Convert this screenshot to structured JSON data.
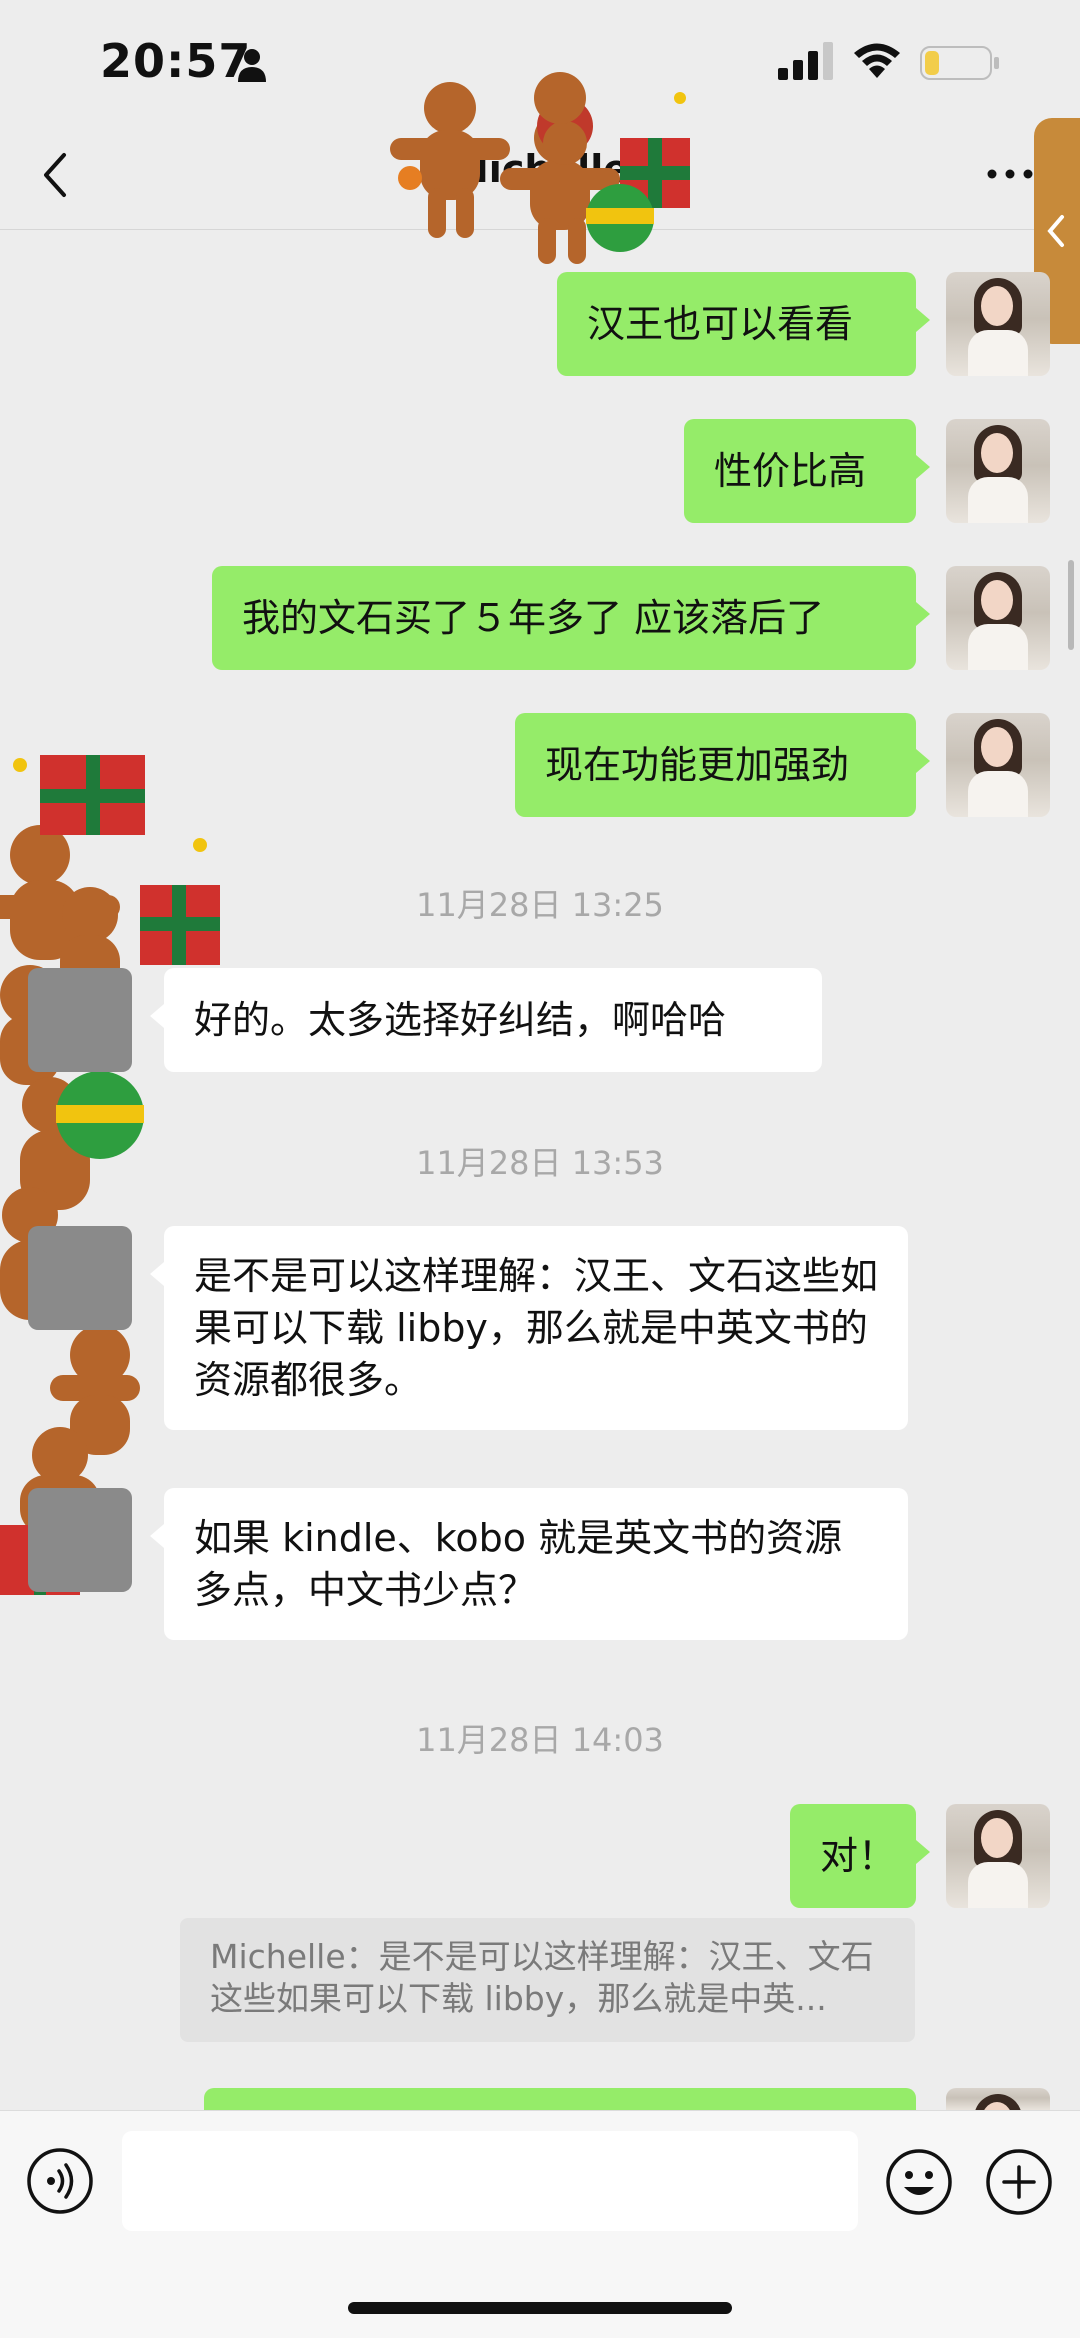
{
  "status_bar": {
    "time": "20:57"
  },
  "chat": {
    "title": "Michelle"
  },
  "messages": [
    {
      "side": "mine",
      "text": "汉王也可以看看"
    },
    {
      "side": "mine",
      "text": "性价比高"
    },
    {
      "side": "mine",
      "text": "我的文石买了５年多了 应该落后了"
    },
    {
      "side": "mine",
      "text": "现在功能更加强劲"
    },
    {
      "type": "time",
      "text": "11月28日 13:25"
    },
    {
      "side": "theirs",
      "text": "好的。太多选择好纠结，啊哈哈"
    },
    {
      "type": "time",
      "text": "11月28日 13:53"
    },
    {
      "side": "theirs",
      "text": "是不是可以这样理解：汉王、文石这些如果可以下载 libby，那么就是中英文书的资源都很多。"
    },
    {
      "side": "theirs",
      "text": "如果 kindle、kobo 就是英文书的资源多点，中文书少点？"
    },
    {
      "type": "time",
      "text": "11月28日 14:03"
    },
    {
      "side": "mine",
      "text": "对！"
    },
    {
      "type": "quote",
      "text": "Michelle：是不是可以这样理解：汉王、文石这些如果可以下载 libby，那么就是中英..."
    }
  ],
  "input": {
    "placeholder": ""
  },
  "icons": {
    "back": "chevron-left-icon",
    "more": "more-icon",
    "voice": "voice-icon",
    "emoji": "emoji-icon",
    "plus": "plus-icon"
  },
  "colors": {
    "my_bubble": "#95ec69",
    "their_bubble": "#ffffff",
    "background": "#ededed"
  }
}
